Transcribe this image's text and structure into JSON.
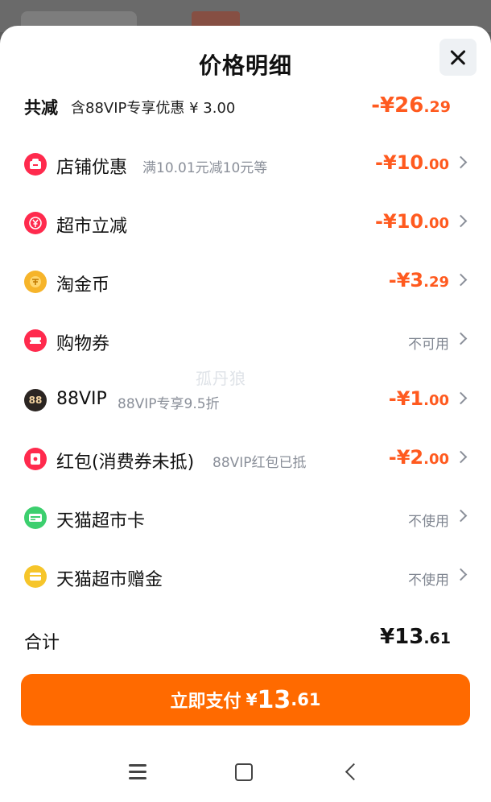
{
  "sheet": {
    "title": "价格明细",
    "watermark": "孤丹狼"
  },
  "summary": {
    "label": "共减",
    "sub": "含88VIP专享优惠 ¥ 3.00",
    "amount_main": "-¥26",
    "amount_decimal": ".29"
  },
  "rows": [
    {
      "label": "店铺优惠",
      "sub": "满10.01元减10元等",
      "amount_main": "-¥10",
      "amount_decimal": ".00",
      "icon": "store-icon",
      "color": "#ff2a4d"
    },
    {
      "label": "超市立减",
      "sub": "",
      "amount_main": "-¥10",
      "amount_decimal": ".00",
      "icon": "yen-coupon-icon",
      "color": "#ff2a4d"
    },
    {
      "label": "淘金币",
      "sub": "",
      "amount_main": "-¥3",
      "amount_decimal": ".29",
      "icon": "coin-icon",
      "color": "#f6b42a"
    },
    {
      "label": "购物券",
      "sub": "",
      "status": "不可用",
      "icon": "ticket-icon",
      "color": "#ff2a4d"
    },
    {
      "label": "88VIP",
      "sub": "88VIP专享9.5折",
      "amount_main": "-¥1",
      "amount_decimal": ".00",
      "icon": "vip88-icon",
      "color": "#2b2522"
    },
    {
      "label": "红包(消费券未抵)",
      "sub": "88VIP红包已抵",
      "amount_main": "-¥2",
      "amount_decimal": ".00",
      "icon": "red-envelope-icon",
      "color": "#ff2a4d"
    },
    {
      "label": "天猫超市卡",
      "sub": "",
      "status": "不使用",
      "icon": "supermarket-card-icon",
      "color": "#3ccf6e"
    },
    {
      "label": "天猫超市赠金",
      "sub": "",
      "status": "不使用",
      "icon": "gift-money-icon",
      "color": "#f6c52a"
    }
  ],
  "total": {
    "label": "合计",
    "amount_main": "¥13",
    "amount_decimal": ".61"
  },
  "pay_button": {
    "label": "立即支付",
    "currency": "¥",
    "amount_main": "13",
    "amount_decimal": ".61",
    "color": "#ff6a00"
  },
  "nav": {
    "menu_icon": "menu-icon",
    "home_icon": "home-icon",
    "back_icon": "back-icon"
  },
  "icons": {
    "close": "close-icon"
  }
}
